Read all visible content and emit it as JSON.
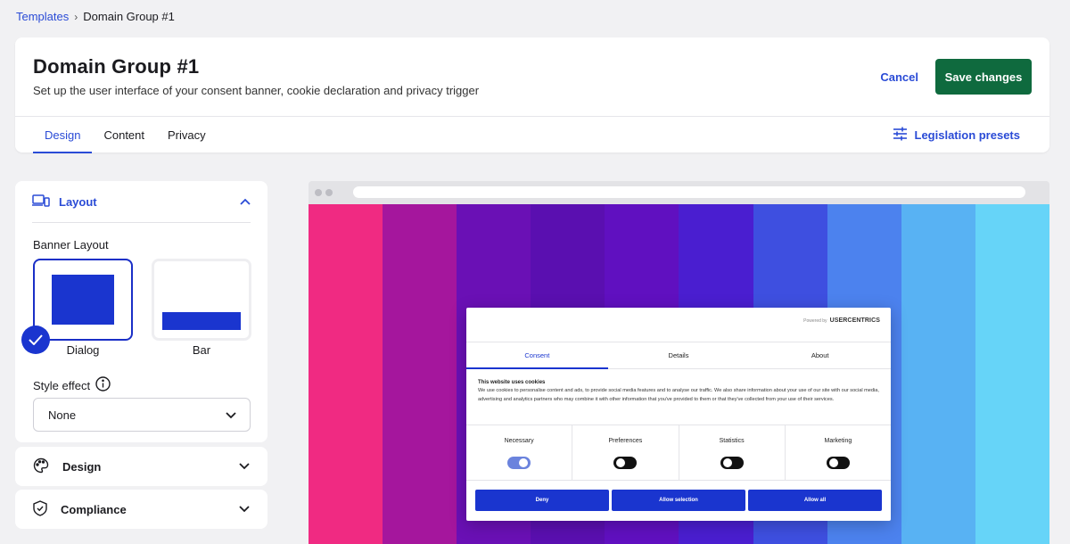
{
  "breadcrumb": {
    "parent": "Templates",
    "separator": "›",
    "current": "Domain Group #1"
  },
  "header": {
    "title": "Domain Group #1",
    "subtitle": "Set up the user interface of your consent banner, cookie declaration and privacy trigger",
    "cancel_label": "Cancel",
    "save_label": "Save changes",
    "tabs": [
      {
        "label": "Design",
        "active": true
      },
      {
        "label": "Content",
        "active": false
      },
      {
        "label": "Privacy",
        "active": false
      }
    ],
    "legislation_label": "Legislation presets"
  },
  "sidebar": {
    "layout": {
      "title": "Layout",
      "banner_layout_label": "Banner Layout",
      "options": [
        {
          "label": "Dialog",
          "selected": true
        },
        {
          "label": "Bar",
          "selected": false
        }
      ],
      "style_effect_label": "Style effect",
      "style_effect_value": "None"
    },
    "design_title": "Design",
    "compliance_title": "Compliance"
  },
  "preview": {
    "gradient_colors": [
      "#f02a82",
      "#a5169d",
      "#6a10b5",
      "#5a0fb0",
      "#6010c0",
      "#4a1ed0",
      "#3e4fe0",
      "#4c82ee",
      "#58b2f3",
      "#66d4f8"
    ],
    "banner": {
      "powered_by": "Powered by",
      "brand": "USERCENTRICS",
      "tabs": [
        {
          "label": "Consent",
          "active": true
        },
        {
          "label": "Details",
          "active": false
        },
        {
          "label": "About",
          "active": false
        }
      ],
      "text_title": "This website uses cookies",
      "text_body": "We use cookies to personalise content and ads, to provide social media features and to analyse our traffic. We also share information about your use of our site with our social media, advertising and analytics partners who may combine it with other information that you've provided to them or that they've collected from your use of their services.",
      "categories": [
        {
          "label": "Necessary",
          "on": true
        },
        {
          "label": "Preferences",
          "on": false
        },
        {
          "label": "Statistics",
          "on": false
        },
        {
          "label": "Marketing",
          "on": false
        }
      ],
      "buttons": [
        "Deny",
        "Allow selection",
        "Allow all"
      ],
      "accent_color": "#1a35cf"
    }
  },
  "colors": {
    "link": "#2a4bd6",
    "save_button": "#0f6a3e",
    "accent": "#1a35cf"
  }
}
